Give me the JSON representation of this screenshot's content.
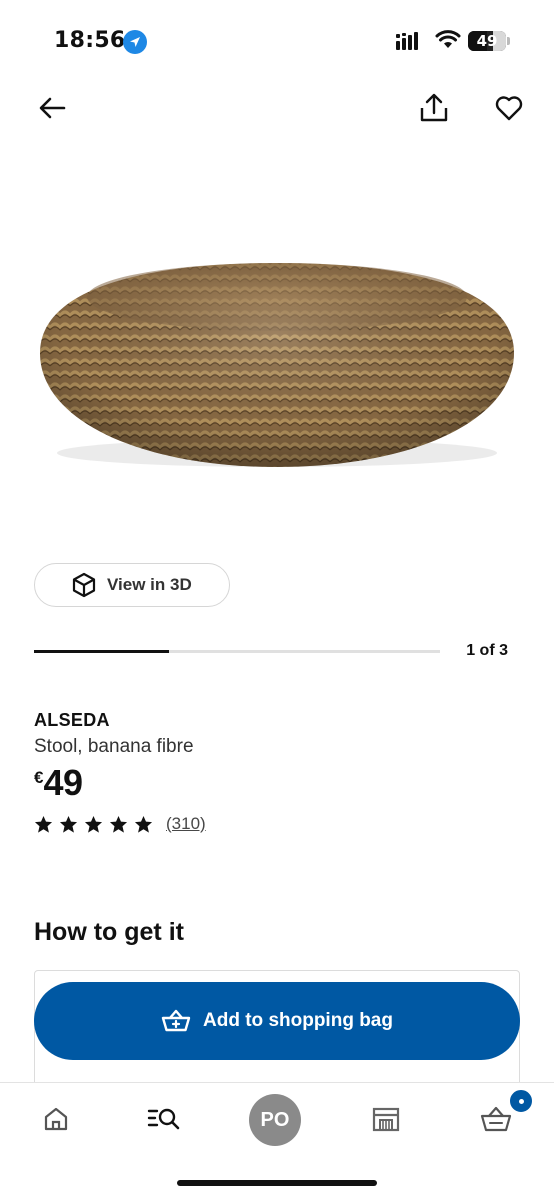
{
  "status_bar": {
    "time": "18:56",
    "battery_level": 49,
    "battery_text": "49",
    "icons": [
      "location-arrow-icon",
      "cellular-signal-icon",
      "wifi-icon",
      "battery-icon"
    ]
  },
  "nav": {
    "icons": [
      "arrow-left-icon",
      "share-icon",
      "heart-icon"
    ]
  },
  "media": {
    "view_3d_label": "View in 3D",
    "view_3d_icon": "cube-icon",
    "carousel_current": 1,
    "carousel_total": 3,
    "carousel_progress": 0.333,
    "carousel_text": "1 of 3"
  },
  "product": {
    "name": "ALSEDA",
    "description": "Stool, banana fibre",
    "price_currency": "€",
    "price_value": "49",
    "rating": 5,
    "review_count": "(310)"
  },
  "purchase": {
    "section_title": "How to get it",
    "add_to_bag_label": "Add to shopping bag",
    "accent_color": "#0058a3"
  },
  "tab_bar": {
    "profile_initials": "PO",
    "icons": [
      "home-icon",
      "search-list-icon",
      "store-icon",
      "basket-icon"
    ],
    "cart_badge_color": "#0058a3"
  }
}
